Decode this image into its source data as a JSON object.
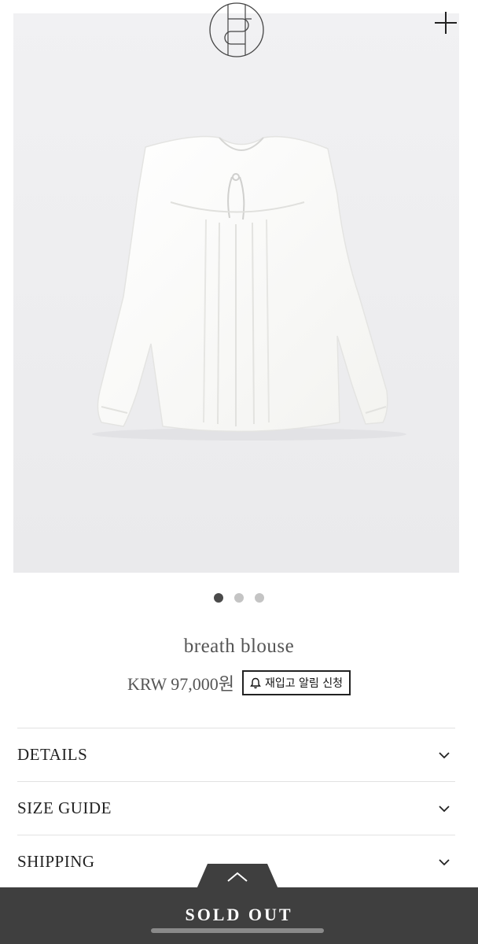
{
  "header": {
    "logo_icon": "brand-monogram-icon",
    "menu_icon": "plus-icon"
  },
  "gallery": {
    "image_subject": "white-blouse",
    "slide_count": 3,
    "active_slide": 1
  },
  "product": {
    "name": "breath blouse",
    "price": "KRW 97,000원",
    "restock_label": "재입고 알림 신청",
    "restock_icon": "bell-icon"
  },
  "accordion": {
    "items": [
      {
        "label": "DETAILS"
      },
      {
        "label": "SIZE GUIDE"
      },
      {
        "label": "SHIPPING"
      }
    ],
    "chevron_icon": "chevron-down-icon"
  },
  "bottom_bar": {
    "label": "SOLD OUT",
    "expand_icon": "chevron-up-icon",
    "background": "#3f3f3f"
  }
}
